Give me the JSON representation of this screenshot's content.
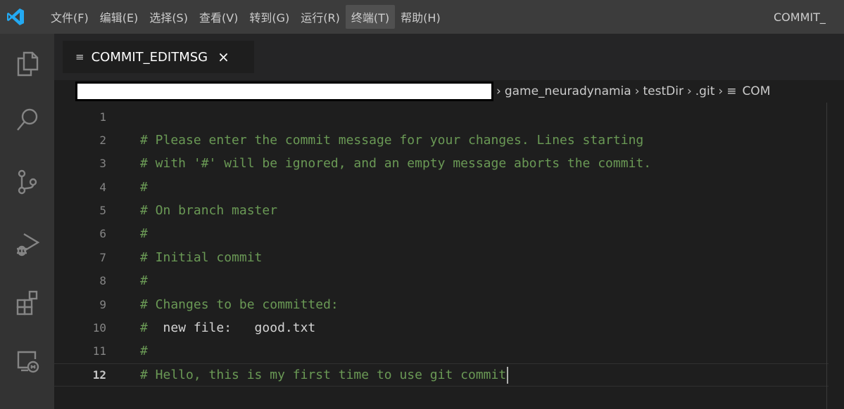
{
  "titlebar": {
    "menu": [
      "文件(F)",
      "编辑(E)",
      "选择(S)",
      "查看(V)",
      "转到(G)",
      "运行(R)",
      "终端(T)",
      "帮助(H)"
    ],
    "window_title": "COMMIT_",
    "accent": "#0078d4"
  },
  "activity_bar": {
    "icons": [
      "explorer-icon",
      "search-icon",
      "source-control-icon",
      "run-debug-icon",
      "extensions-icon",
      "remote-explorer-icon"
    ]
  },
  "tab": {
    "label": "COMMIT_EDITMSG",
    "close": "×"
  },
  "breadcrumb": {
    "items": [
      "game_neuradynamia",
      "testDir",
      ".git",
      "COM"
    ],
    "separator": "›"
  },
  "editor": {
    "lines": [
      {
        "num": "1",
        "text": ""
      },
      {
        "num": "2",
        "text": "# Please enter the commit message for your changes. Lines starting"
      },
      {
        "num": "3",
        "text": "# with '#' will be ignored, and an empty message aborts the commit."
      },
      {
        "num": "4",
        "text": "#"
      },
      {
        "num": "5",
        "text": "# On branch master"
      },
      {
        "num": "6",
        "text": "#"
      },
      {
        "num": "7",
        "text": "# Initial commit"
      },
      {
        "num": "8",
        "text": "#"
      },
      {
        "num": "9",
        "text": "# Changes to be committed:"
      },
      {
        "num": "10",
        "text_hash": "#",
        "text_body": "  new file:   good.txt"
      },
      {
        "num": "11",
        "text": "#"
      },
      {
        "num": "12",
        "text": "# Hello, this is my first time to use git commit"
      }
    ],
    "comment_color": "#6a9955"
  }
}
